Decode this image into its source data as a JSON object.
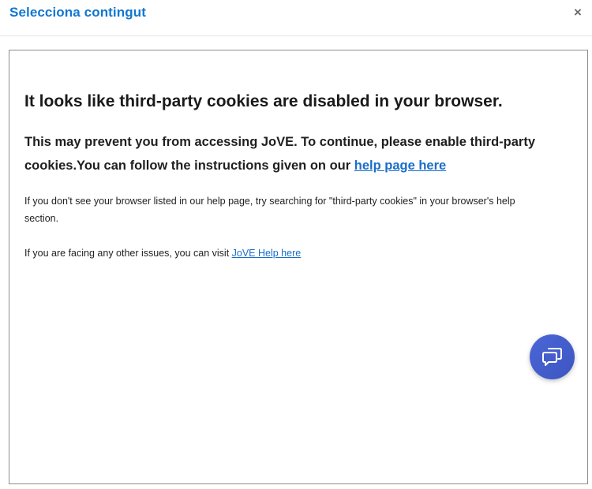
{
  "dialog": {
    "title": "Selecciona contingut",
    "close_label": "×"
  },
  "notice": {
    "heading": "It looks like third-party cookies are disabled in your browser.",
    "lead_text": "This may prevent you from accessing JoVE. To continue, please enable third-party cookies.You can follow the instructions given on our ",
    "lead_link": "help page here",
    "small_text_1": "If you don't see your browser listed in our help page, try searching for \"third-party cookies\" in your browser's help section.",
    "small_text_2": "If you are facing any other issues, you can visit ",
    "small_link": "JoVE Help here"
  },
  "chat": {
    "icon": "chat-bubbles-icon"
  },
  "colors": {
    "title": "#1177d1",
    "link": "#1a6dc9",
    "chat_button": "#4a67d6"
  }
}
